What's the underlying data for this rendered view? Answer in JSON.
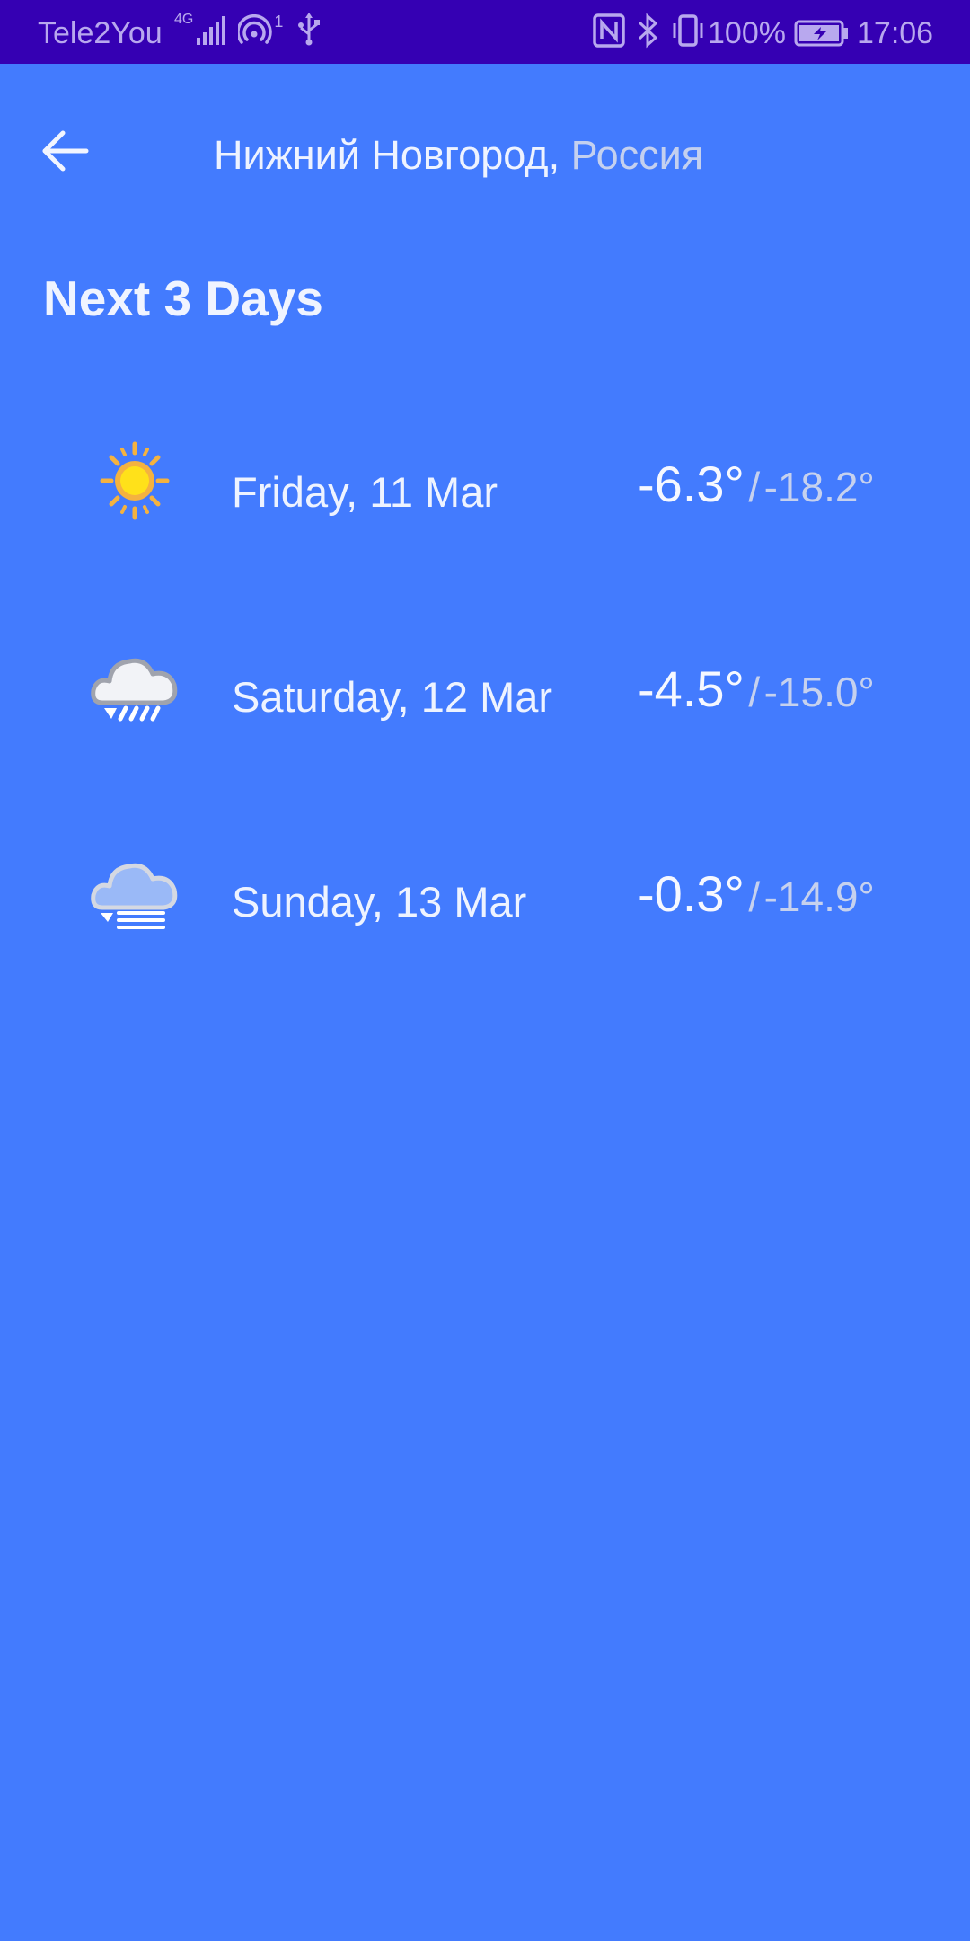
{
  "status_bar": {
    "carrier": "Tele2You",
    "network_type": "4G",
    "hotspot_count": "1",
    "battery_percent": "100%",
    "time": "17:06"
  },
  "header": {
    "city": "Нижний Новгород,",
    "country": "Россия"
  },
  "section_title": "Next 3 Days",
  "forecast": [
    {
      "icon": "sun-icon",
      "date": "Friday, 11 Mar",
      "high": "-6.3°",
      "separator": "/",
      "low": "-18.2°"
    },
    {
      "icon": "cloud-snow-icon",
      "date": "Saturday, 12 Mar",
      "high": "-4.5°",
      "separator": "/",
      "low": "-15.0°"
    },
    {
      "icon": "cloud-fog-icon",
      "date": "Sunday, 13 Mar",
      "high": "-0.3°",
      "separator": "/",
      "low": "-14.9°"
    }
  ],
  "colors": {
    "background": "#437bfe",
    "status_bar": "#3500b3",
    "text_primary": "#eef3ff",
    "text_secondary": "#c4d0ef"
  }
}
